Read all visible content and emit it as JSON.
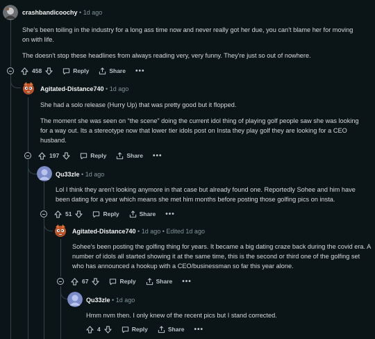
{
  "comments": [
    {
      "username": "crashbandicoochy",
      "time": "1d ago",
      "edited": "",
      "paragraphs": [
        "She's been toiling in the industry for a long ass time now and never really got her due, you can't blame her for moving on with life.",
        "The doesn't stop these headlines from always reading very, very funny. They're just so out of nowhere."
      ],
      "votes": "458",
      "reply_label": "Reply",
      "share_label": "Share",
      "more_label": "•••"
    },
    {
      "username": "Agitated-Distance740",
      "time": "1d ago",
      "edited": "",
      "paragraphs": [
        "She had a solo release (Hurry Up) that was pretty good but it flopped.",
        "The moment she was seen on “the scene” doing the current idol thing of playing golf people saw she was looking for a way out. Its a stereotype now that lower tier idols post on Insta they play golf they are looking for a CEO husband."
      ],
      "votes": "197",
      "reply_label": "Reply",
      "share_label": "Share",
      "more_label": "•••"
    },
    {
      "username": "Qu33zle",
      "time": "1d ago",
      "edited": "",
      "paragraphs": [
        "Lol I think they aren't looking anymore in that case but already found one. Reportedly Sohee and him have been dating for a year which means she met him months before posting those golfing pics on insta."
      ],
      "votes": "51",
      "reply_label": "Reply",
      "share_label": "Share",
      "more_label": "•••"
    },
    {
      "username": "Agitated-Distance740",
      "time": "1d ago",
      "edited": "Edited 1d ago",
      "paragraphs": [
        "Sohee's been posting the golfing thing for years. It became a big dating craze back during the covid era. A number of idols all started showing it at the same time, this is the second or third one of the golfing set who has announced a hookup with a CEO/businessman so far this year alone."
      ],
      "votes": "67",
      "reply_label": "Reply",
      "share_label": "Share",
      "more_label": "•••"
    },
    {
      "username": "Qu33zle",
      "time": "1d ago",
      "edited": "",
      "paragraphs": [
        "Hmm nvm then. I only knew of the recent pics but I stand corrected."
      ],
      "votes": "4",
      "reply_label": "Reply",
      "share_label": "Share",
      "more_label": "•••"
    }
  ],
  "colors": {
    "background": "#0b1416",
    "text": "#d7dadc",
    "meta": "#82959b",
    "thread_line": "#33464c"
  },
  "icons": [
    "upvote-icon",
    "downvote-icon",
    "reply-icon",
    "share-icon",
    "collapse-icon",
    "more-icon"
  ]
}
